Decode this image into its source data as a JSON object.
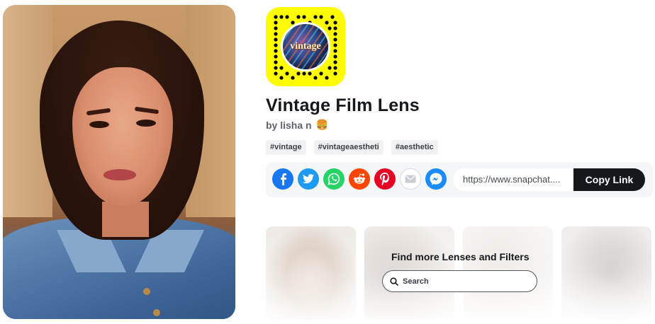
{
  "lens": {
    "name": "Vintage Film Lens",
    "creator": "by lisha n",
    "creator_badge": "🍔",
    "snapcode_text": "vintage",
    "tags": [
      "#vintage",
      "#vintageaestheti",
      "#aesthetic"
    ]
  },
  "share": {
    "link_value": "https://www.snapchat....",
    "copy_label": "Copy Link",
    "icons": [
      {
        "name": "facebook-icon",
        "color": "#1877f2"
      },
      {
        "name": "twitter-icon",
        "color": "#1d9bf0"
      },
      {
        "name": "whatsapp-icon",
        "color": "#25d366"
      },
      {
        "name": "reddit-icon",
        "color": "#ff4500"
      },
      {
        "name": "pinterest-icon",
        "color": "#e60023"
      },
      {
        "name": "email-icon",
        "color": "#ffffff"
      },
      {
        "name": "messenger-icon",
        "color": "#1a8cff"
      }
    ]
  },
  "discover": {
    "title": "Find more Lenses and Filters",
    "search_placeholder": "Search"
  },
  "colors": {
    "snapcode_yellow": "#fffc00",
    "primary_text": "#16191c",
    "secondary_text": "#5d636b",
    "button_dark": "#16191c"
  }
}
